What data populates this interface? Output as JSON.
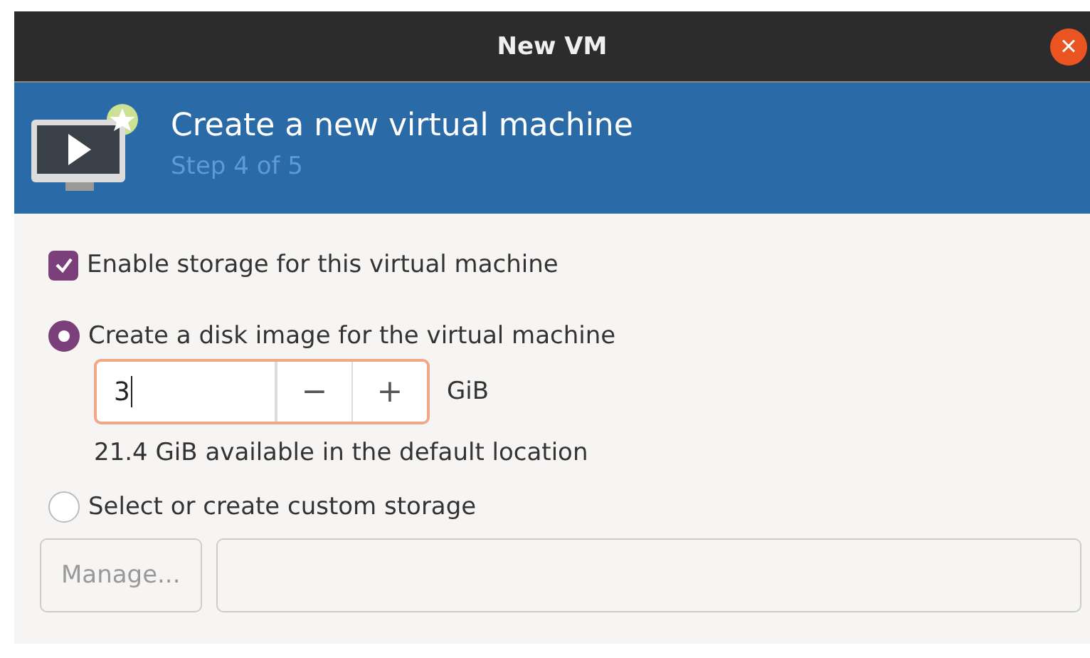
{
  "window": {
    "title": "New VM",
    "close_icon": "×"
  },
  "header": {
    "title": "Create a new virtual machine",
    "step": "Step 4 of 5"
  },
  "enable_storage": {
    "label": "Enable storage for this virtual machine",
    "checked": true
  },
  "storage_options": [
    {
      "kind": "disk",
      "label": "Create a disk image for the virtual machine",
      "selected": true,
      "size": {
        "value": "3",
        "decrement": "−",
        "increment": "+",
        "unit": "GiB",
        "focused": true
      },
      "note": "21.4 GiB available in the default location"
    },
    {
      "kind": "custom",
      "label": "Select or create custom storage",
      "selected": false,
      "manage_button": {
        "label": "Manage...",
        "disabled": true
      }
    }
  ]
}
